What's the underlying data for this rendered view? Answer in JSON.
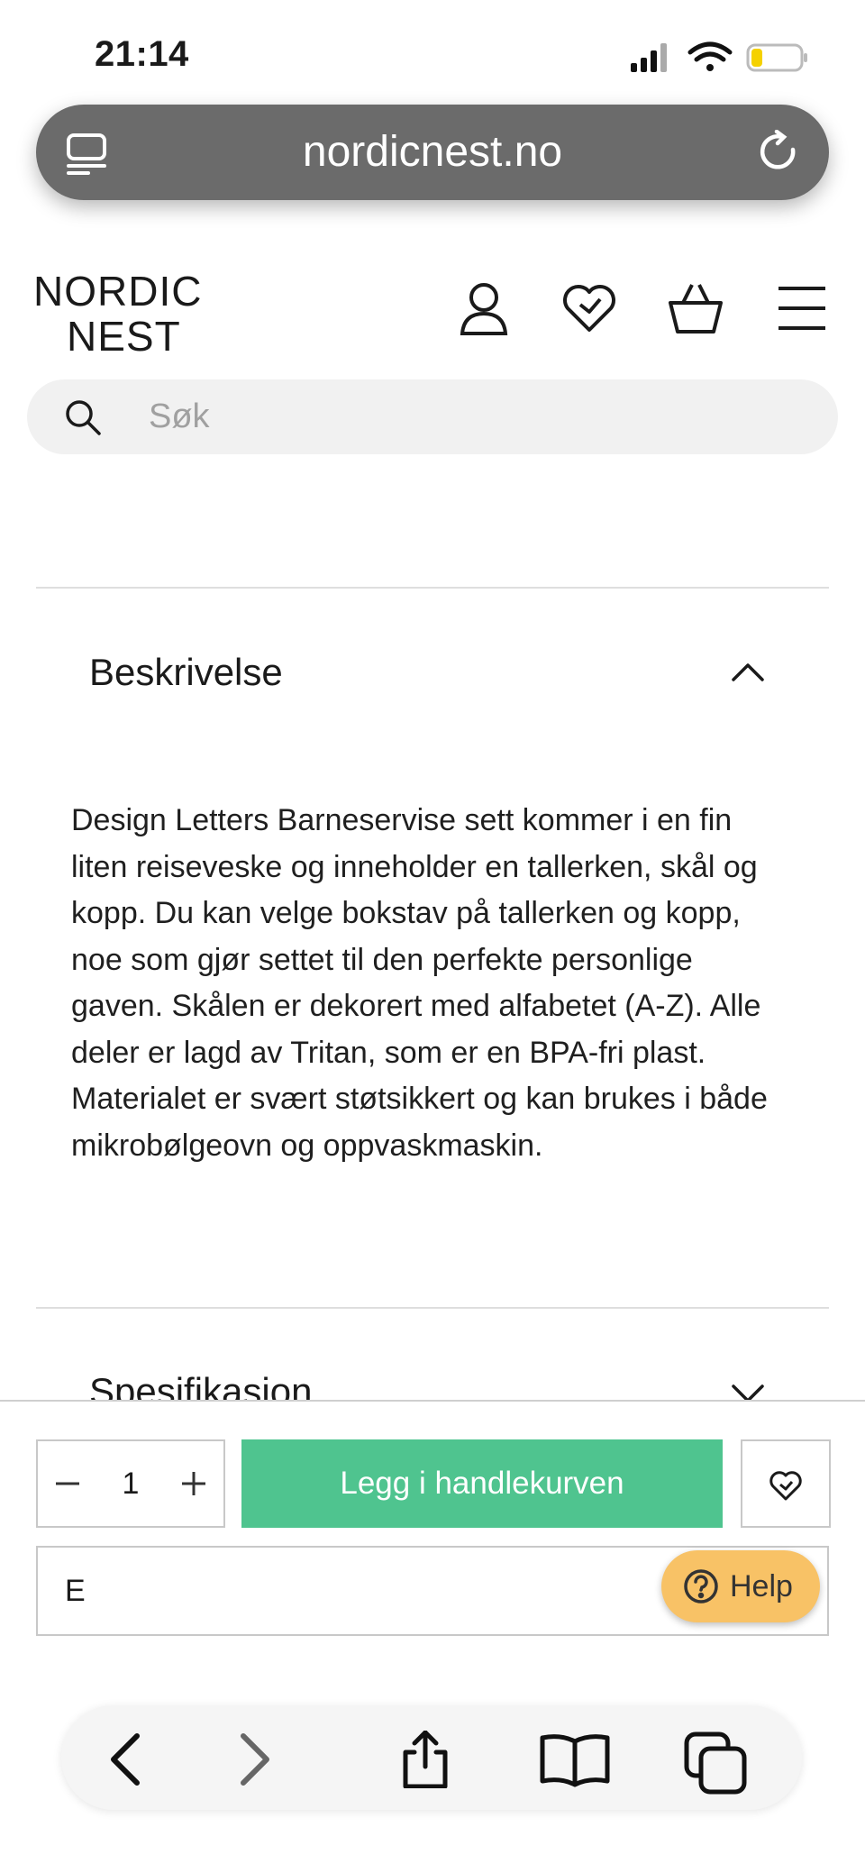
{
  "status_bar": {
    "time": "21:14"
  },
  "browser": {
    "url": "nordicnest.no"
  },
  "site": {
    "logo_line1": "NORDIC",
    "logo_line2": "NEST",
    "search_placeholder": "Søk"
  },
  "accordion": {
    "description_title": "Beskrivelse",
    "description_text": "Design Letters Barneservise sett kommer i en fin liten reiseveske og inneholder en tallerken, skål og kopp. Du kan velge bokstav på tallerken og kopp, noe som gjør settet til den perfekte personlige gaven. Skålen er dekorert med alfabetet (A-Z). Alle deler er lagd av Tritan, som er en BPA-fri plast. Materialet er svært støtsikkert og kan brukes i både mikrobølgeovn og oppvaskmaskin.",
    "specification_title": "Spesifikasjon"
  },
  "purchase": {
    "quantity": "1",
    "add_to_cart_label": "Legg i handlekurven",
    "letter_field_value": "E",
    "help_label": "Help",
    "add_to_cart_color": "#4fc48f",
    "help_color": "#f8c266"
  },
  "icons": {
    "header": [
      "user-icon",
      "heart-icon",
      "basket-icon",
      "menu-icon"
    ],
    "toolbar": [
      "back-icon",
      "forward-icon",
      "share-icon",
      "bookmarks-icon",
      "tabs-icon"
    ]
  }
}
